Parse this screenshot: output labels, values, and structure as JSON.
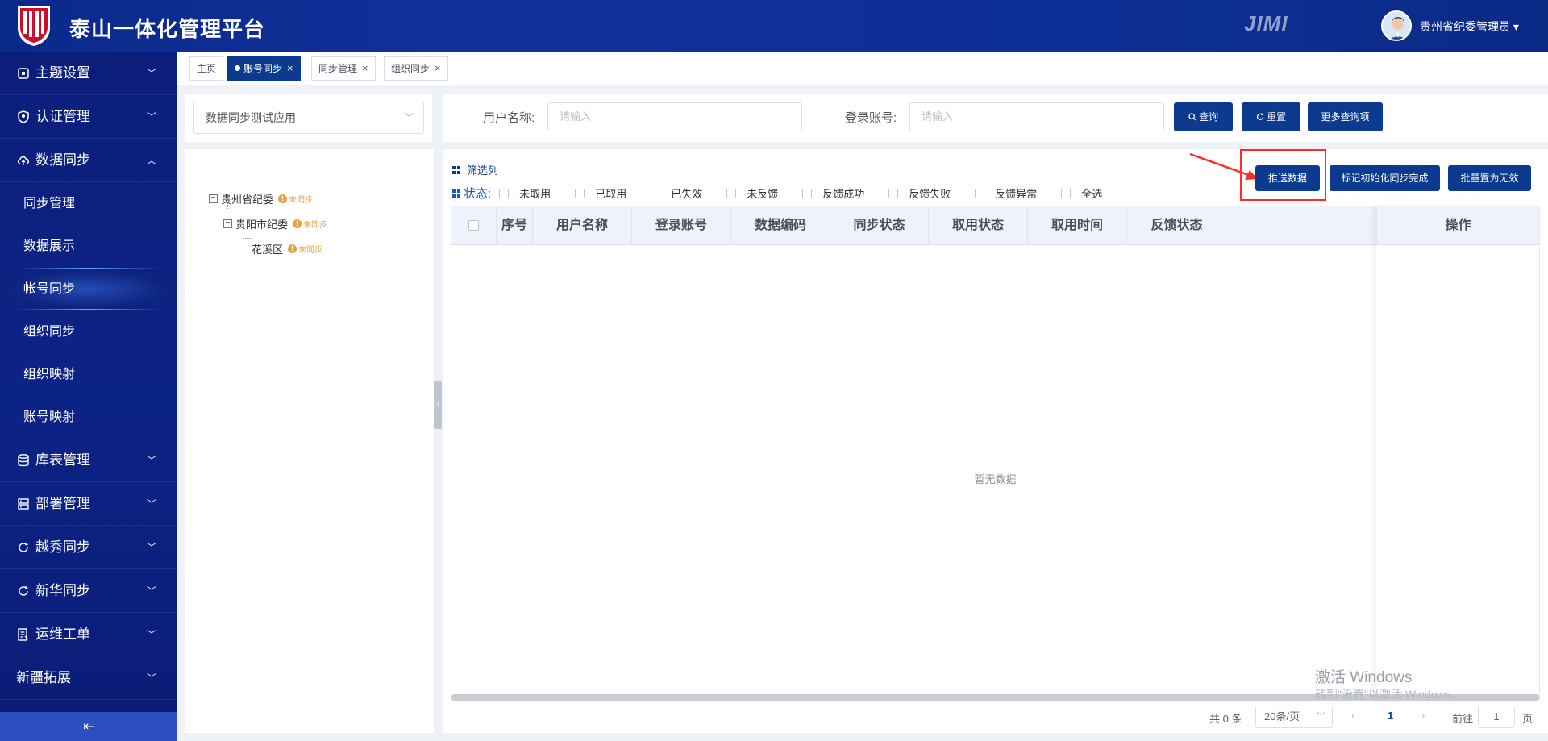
{
  "header": {
    "app_title": "泰山一体化管理平台",
    "brand": "JIMI",
    "user_name": "贵州省纪委管理员",
    "user_caret": "▾"
  },
  "sidebar": {
    "groups_top": [
      {
        "label": "主题设置",
        "icon": "theme-icon",
        "chevron": "﹀"
      },
      {
        "label": "认证管理",
        "icon": "shield-icon",
        "chevron": "﹀"
      },
      {
        "label": "数据同步",
        "icon": "cloud-sync-icon",
        "chevron": "︿"
      }
    ],
    "sub_items": [
      {
        "label": "同步管理"
      },
      {
        "label": "数据展示"
      },
      {
        "label": "帐号同步"
      },
      {
        "label": "组织同步"
      },
      {
        "label": "组织映射"
      },
      {
        "label": "账号映射"
      }
    ],
    "groups_bottom": [
      {
        "label": "库表管理",
        "icon": "database-icon",
        "chevron": "﹀"
      },
      {
        "label": "部署管理",
        "icon": "server-icon",
        "chevron": "﹀"
      },
      {
        "label": "越秀同步",
        "icon": "sync-icon",
        "chevron": "﹀"
      },
      {
        "label": "新华同步",
        "icon": "sync-icon",
        "chevron": "﹀"
      },
      {
        "label": "运维工单",
        "icon": "ticket-icon",
        "chevron": "﹀"
      },
      {
        "label": "新疆拓展",
        "icon": "",
        "chevron": "﹀"
      }
    ],
    "collapse_glyph": "⇤"
  },
  "tabs": [
    {
      "label": "主页"
    },
    {
      "label": "账号同步",
      "close": "×"
    },
    {
      "label": "同步管理",
      "close": "×"
    },
    {
      "label": "组织同步",
      "close": "×"
    }
  ],
  "left": {
    "app_select_value": "数据同步测试应用",
    "select_arrow": "﹀",
    "tree": [
      {
        "label": "贵州省纪委",
        "toggle": "−",
        "status": "未同步"
      },
      {
        "label": "贵阳市纪委",
        "toggle": "−",
        "status": "未同步"
      },
      {
        "label": "花溪区",
        "status": "未同步"
      }
    ],
    "splitter_glyph": "‹"
  },
  "search": {
    "user_name_label": "用户名称:",
    "user_name_placeholder": "请输入",
    "login_account_label": "登录账号:",
    "login_account_placeholder": "请输入",
    "query_label": "查询",
    "reset_label": "重置",
    "more_label": "更多查询项"
  },
  "toolbar": {
    "filter_columns_label": "筛选列",
    "status_label": "状态:",
    "status_options": [
      "未取用",
      "已取用",
      "已失效",
      "未反馈",
      "反馈成功",
      "反馈失败",
      "反馈异常",
      "全选"
    ],
    "push_label": "推送数据",
    "mark_init_label": "标记初始化同步完成",
    "batch_invalid_label": "批量置为无效"
  },
  "table": {
    "columns": [
      "序号",
      "用户名称",
      "登录账号",
      "数据编码",
      "同步状态",
      "取用状态",
      "取用时间",
      "反馈状态",
      "操作"
    ],
    "rows": [],
    "empty_text": "暂无数据"
  },
  "pagination": {
    "total_text": "共 0 条",
    "page_size": "20条/页",
    "size_arrow": "﹀",
    "prev": "‹",
    "current_page": "1",
    "next": "›",
    "goto_label": "前往",
    "goto_value": "1",
    "page_suffix": "页"
  },
  "watermark": {
    "line1": "激活 Windows",
    "line2": "转到\"设置\"以激活 Windows。"
  },
  "colors": {
    "primary": "#0b3a8e",
    "header_bg": "#0e2f96",
    "sidebar_bg": "#0b1e7a",
    "highlight": "#ff2b2b",
    "warning": "#e6a23c"
  }
}
